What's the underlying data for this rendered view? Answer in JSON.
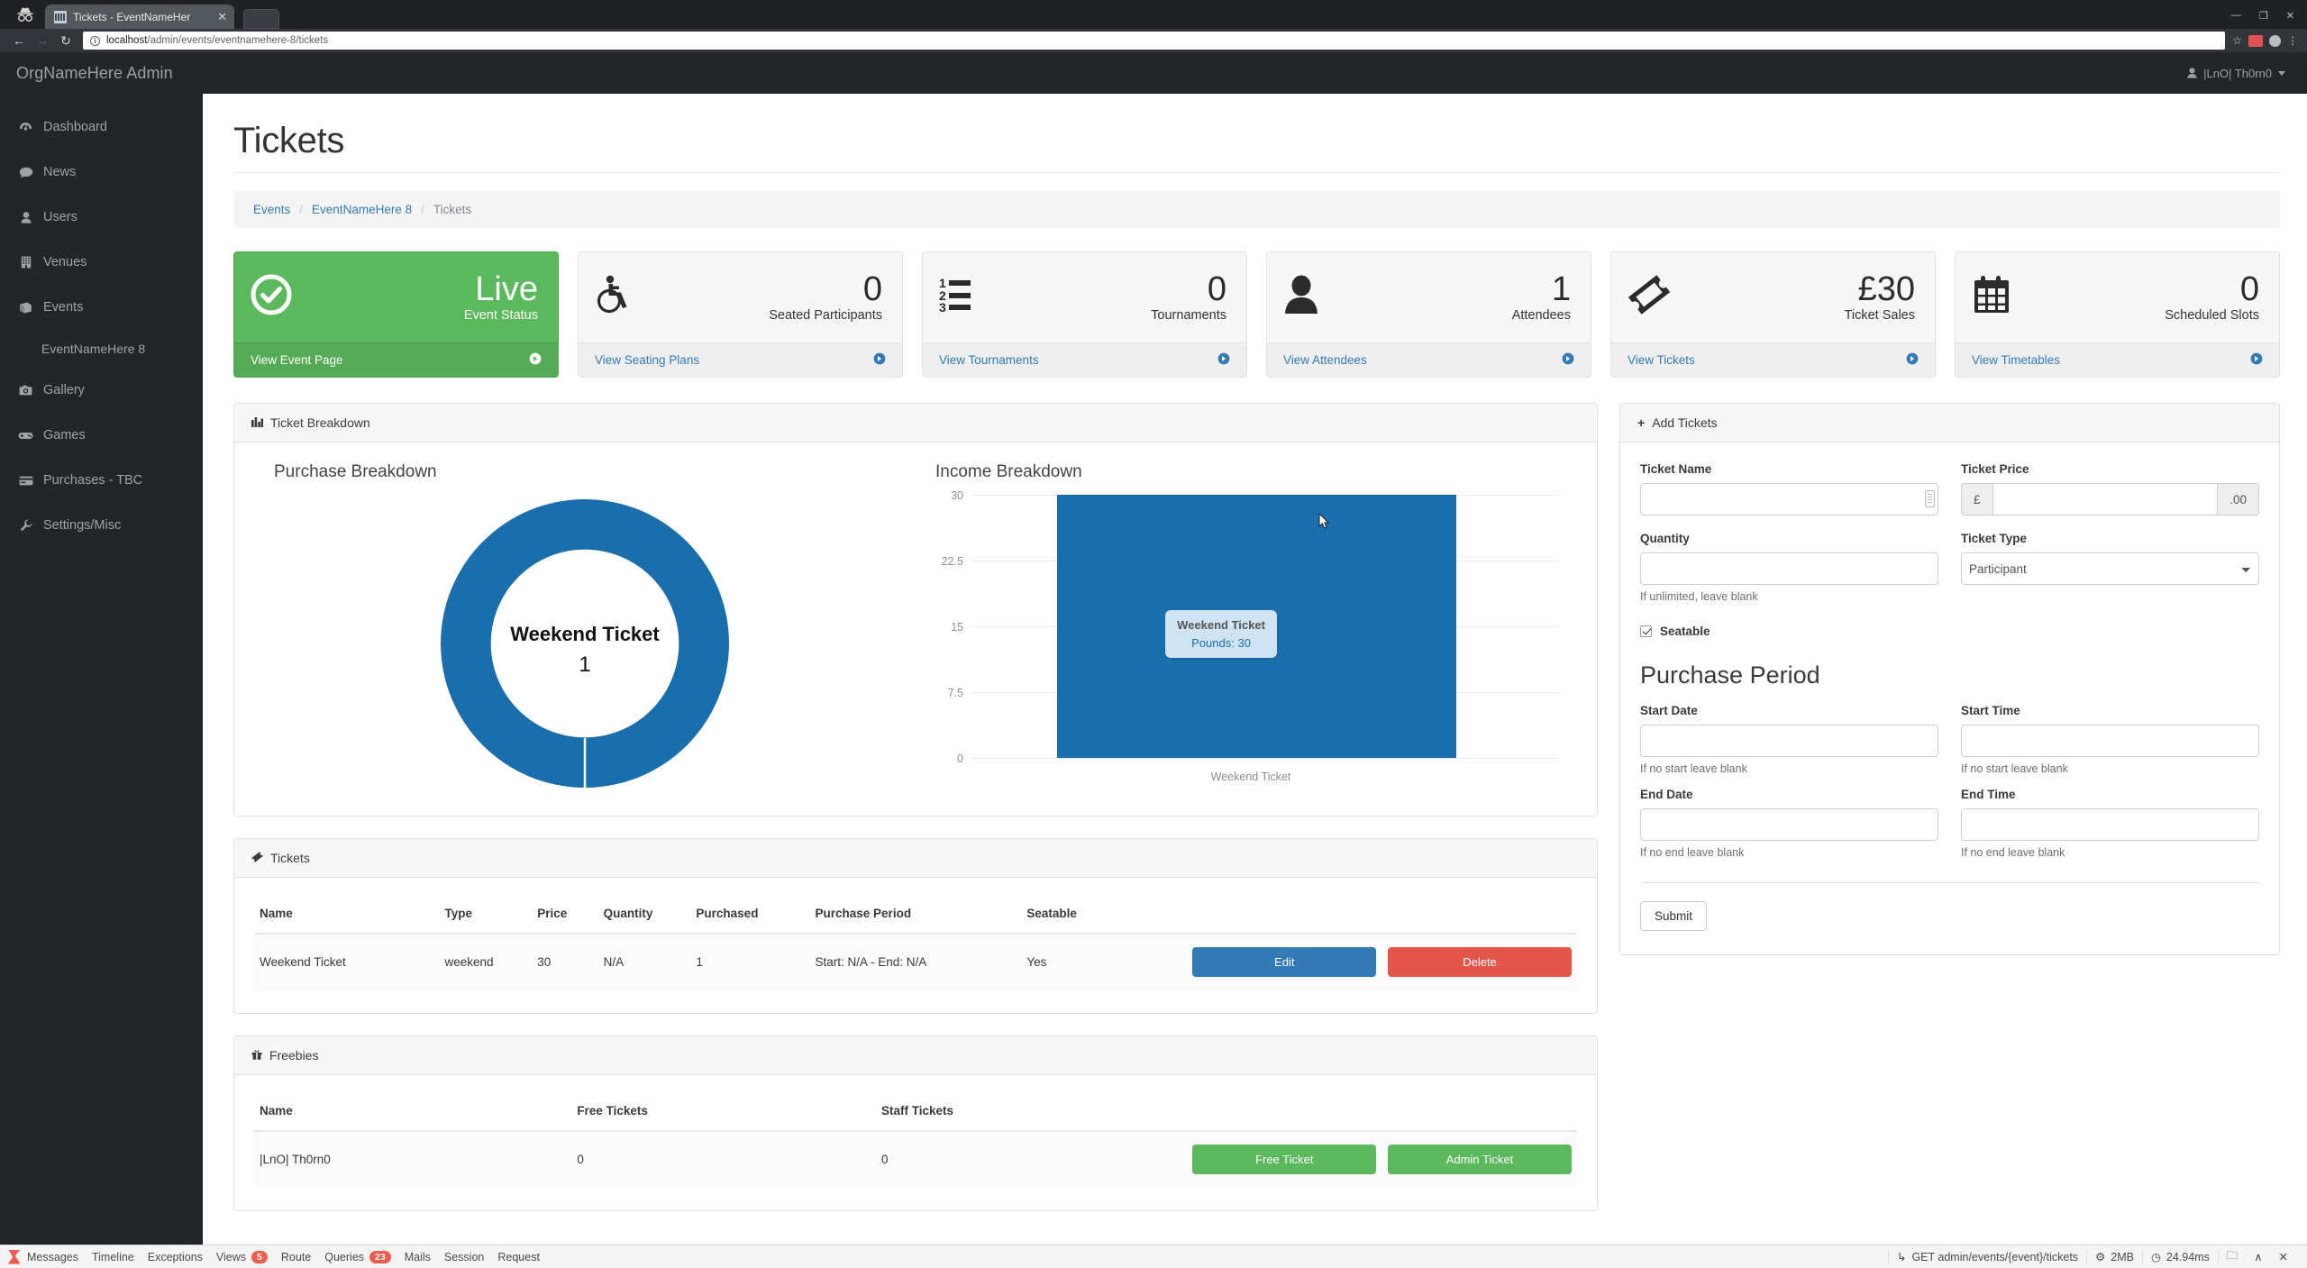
{
  "browser": {
    "tab_title": "Tickets - EventNameHer",
    "close_label": "✕",
    "back_icon": "←",
    "forward_icon": "→",
    "reload_icon": "↻",
    "info_icon": "i",
    "url_host": "localhost",
    "url_path": "/admin/events/eventnamehere-8/tickets",
    "star_icon": "☆",
    "menu_icon": "⋮",
    "win_min": "—",
    "win_max": "❐",
    "win_close": "✕"
  },
  "topbar": {
    "brand": "OrgNameHere Admin",
    "user": "|LnO| Th0rn0",
    "user_icon": "👤"
  },
  "sidebar": {
    "items": [
      {
        "label": "Dashboard",
        "icon": "◔"
      },
      {
        "label": "News",
        "icon": "💬"
      },
      {
        "label": "Users",
        "icon": "👤"
      },
      {
        "label": "Venues",
        "icon": "🏢"
      },
      {
        "label": "Events",
        "icon": "📕"
      }
    ],
    "sub_item": "EventNameHere 8",
    "items_after": [
      {
        "label": "Gallery",
        "icon": "📷"
      },
      {
        "label": "Games",
        "icon": "🎮"
      },
      {
        "label": "Purchases - TBC",
        "icon": "💳"
      },
      {
        "label": "Settings/Misc",
        "icon": "🔧"
      }
    ]
  },
  "page": {
    "title": "Tickets",
    "breadcrumb": [
      {
        "label": "Events",
        "link": true
      },
      {
        "label": "EventNameHere 8",
        "link": true
      },
      {
        "label": "Tickets",
        "link": false
      }
    ],
    "breadcrumb_sep": "/"
  },
  "cards": [
    {
      "value": "Live",
      "label": "Event Status",
      "link": "View Event Page",
      "icon": "check-circle"
    },
    {
      "value": "0",
      "label": "Seated Participants",
      "link": "View Seating Plans",
      "icon": "wheelchair"
    },
    {
      "value": "0",
      "label": "Tournaments",
      "link": "View Tournaments",
      "icon": "ordered-list"
    },
    {
      "value": "1",
      "label": "Attendees",
      "link": "View Attendees",
      "icon": "person"
    },
    {
      "value": "£30",
      "label": "Ticket Sales",
      "link": "View Tickets",
      "icon": "ticket"
    },
    {
      "value": "0",
      "label": "Scheduled Slots",
      "link": "View Timetables",
      "icon": "calendar"
    }
  ],
  "breakdown_panel": {
    "title": "Ticket Breakdown",
    "icon": "bar-chart-icon"
  },
  "chart_data": [
    {
      "type": "pie",
      "title": "Purchase Breakdown",
      "labels": [
        "Weekend Ticket"
      ],
      "values": [
        1
      ],
      "colors": [
        "#1a6eac"
      ],
      "center_label": "Weekend Ticket",
      "center_value": "1",
      "donut": true,
      "legend": "none"
    },
    {
      "type": "bar",
      "title": "Income Breakdown",
      "categories": [
        "Weekend Ticket"
      ],
      "values": [
        30
      ],
      "series": [
        {
          "name": "Pounds",
          "values": [
            30
          ]
        }
      ],
      "ylim": [
        0,
        30
      ],
      "yticks": [
        "0",
        "7.5",
        "15",
        "22.5",
        "30"
      ],
      "xlabel": "",
      "ylabel": "",
      "grid": true,
      "color": "#1a6eac",
      "tooltip": {
        "title": "Weekend Ticket",
        "value": "Pounds: 30"
      }
    }
  ],
  "tickets_panel": {
    "title": "Tickets",
    "icon": "ticket-icon",
    "columns": [
      "Name",
      "Type",
      "Price",
      "Quantity",
      "Purchased",
      "Purchase Period",
      "Seatable",
      ""
    ],
    "rows": [
      {
        "name": "Weekend Ticket",
        "type": "weekend",
        "price": "30",
        "quantity": "N/A",
        "purchased": "1",
        "period": "Start: N/A - End: N/A",
        "seatable": "Yes",
        "edit_label": "Edit",
        "delete_label": "Delete"
      }
    ]
  },
  "freebies_panel": {
    "title": "Freebies",
    "icon": "gift-icon",
    "columns": [
      "Name",
      "Free Tickets",
      "Staff Tickets",
      ""
    ],
    "rows": [
      {
        "name": "|LnO| Th0rn0",
        "free_tickets": "0",
        "staff_tickets": "0",
        "free_label": "Free Ticket",
        "admin_label": "Admin Ticket"
      }
    ]
  },
  "add_tickets": {
    "title": "Add Tickets",
    "icon": "plus-icon",
    "ticket_name_label": "Ticket Name",
    "ticket_name_value": "",
    "ticket_price_label": "Ticket Price",
    "ticket_price_value": "",
    "price_prefix": "£",
    "price_suffix": ".00",
    "quantity_label": "Quantity",
    "quantity_value": "",
    "quantity_help": "If unlimited, leave blank",
    "ticket_type_label": "Ticket Type",
    "ticket_type_value": "Participant",
    "ticket_type_options": [
      "Participant"
    ],
    "seatable_label": "Seatable",
    "seatable_checked": true,
    "purchase_period_title": "Purchase Period",
    "start_date_label": "Start Date",
    "start_date_value": "",
    "start_date_help": "If no start leave blank",
    "start_time_label": "Start Time",
    "start_time_value": "",
    "start_time_help": "If no start leave blank",
    "end_date_label": "End Date",
    "end_date_value": "",
    "end_date_help": "If no end leave blank",
    "end_time_label": "End Time",
    "end_time_value": "",
    "end_time_help": "If no end leave blank",
    "submit_label": "Submit"
  },
  "debugbar": {
    "items": [
      {
        "label": "Messages",
        "badge": ""
      },
      {
        "label": "Timeline",
        "badge": ""
      },
      {
        "label": "Exceptions",
        "badge": ""
      },
      {
        "label": "Views",
        "badge": "5"
      },
      {
        "label": "Route",
        "badge": ""
      },
      {
        "label": "Queries",
        "badge": "23"
      },
      {
        "label": "Mails",
        "badge": ""
      },
      {
        "label": "Session",
        "badge": ""
      },
      {
        "label": "Request",
        "badge": ""
      }
    ],
    "route": "GET admin/events/{event}/tickets",
    "memory": "2MB",
    "time": "24.94ms",
    "route_icon": "↳",
    "memory_icon": "⚙",
    "time_icon": "◷",
    "folder_icon": "🗀",
    "collapse_icon": "∧",
    "close_icon": "✕"
  }
}
